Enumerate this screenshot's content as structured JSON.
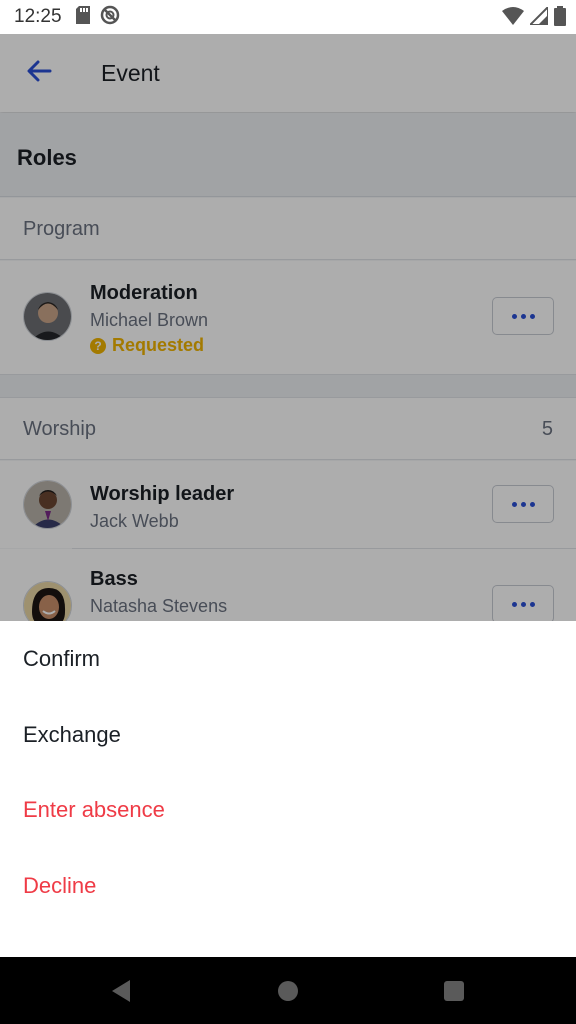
{
  "status_bar": {
    "time": "12:25",
    "icons": [
      "sd-card-icon",
      "no-sync-icon",
      "wifi-icon",
      "signal-icon",
      "battery-icon"
    ]
  },
  "app_bar": {
    "title": "Event",
    "back_icon": "arrow-left-icon"
  },
  "roles_section": {
    "title": "Roles"
  },
  "groups": [
    {
      "label": "Program",
      "count": "",
      "roles": [
        {
          "role": "Moderation",
          "person": "Michael Brown",
          "status": "Requested"
        }
      ]
    },
    {
      "label": "Worship",
      "count": "5",
      "roles": [
        {
          "role": "Worship leader",
          "person": "Jack Webb"
        },
        {
          "role": "Bass",
          "person": "Natasha Stevens"
        }
      ]
    }
  ],
  "sheet": {
    "items": [
      {
        "label": "Confirm",
        "style": "normal"
      },
      {
        "label": "Exchange",
        "style": "normal"
      },
      {
        "label": "Enter absence",
        "style": "danger"
      },
      {
        "label": "Decline",
        "style": "danger"
      }
    ]
  },
  "colors": {
    "accent": "#2a4fd6",
    "warning": "#f1b400",
    "danger": "#ef3b46"
  }
}
